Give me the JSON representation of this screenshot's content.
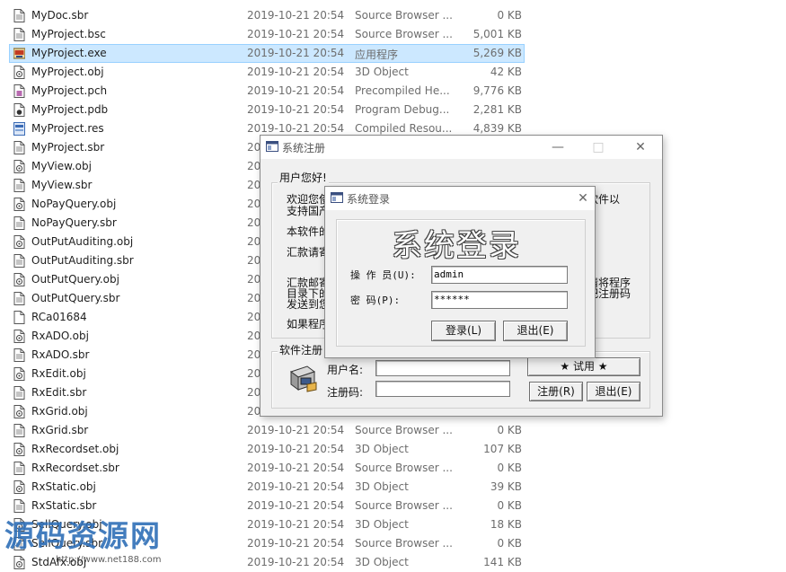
{
  "files": [
    {
      "name": "MyDoc.sbr",
      "date": "2019-10-21 20:54",
      "type": "Source Browser ...",
      "size": "0 KB",
      "icon": "doc-icon"
    },
    {
      "name": "MyProject.bsc",
      "date": "2019-10-21 20:54",
      "type": "Source Browser ...",
      "size": "5,001 KB",
      "icon": "doc-icon"
    },
    {
      "name": "MyProject.exe",
      "date": "2019-10-21 20:54",
      "type": "应用程序",
      "size": "5,269 KB",
      "icon": "exe-icon",
      "selected": true
    },
    {
      "name": "MyProject.obj",
      "date": "2019-10-21 20:54",
      "type": "3D Object",
      "size": "42 KB",
      "icon": "object-icon"
    },
    {
      "name": "MyProject.pch",
      "date": "2019-10-21 20:54",
      "type": "Precompiled He...",
      "size": "9,776 KB",
      "icon": "pch-icon"
    },
    {
      "name": "MyProject.pdb",
      "date": "2019-10-21 20:54",
      "type": "Program Debug...",
      "size": "2,281 KB",
      "icon": "pdb-icon"
    },
    {
      "name": "MyProject.res",
      "date": "2019-10-21 20:54",
      "type": "Compiled Resou...",
      "size": "4,839 KB",
      "icon": "res-icon"
    },
    {
      "name": "MyProject.sbr",
      "date": "20",
      "type": "",
      "size": "",
      "icon": "doc-icon"
    },
    {
      "name": "MyView.obj",
      "date": "20",
      "type": "",
      "size": "",
      "icon": "object-icon"
    },
    {
      "name": "MyView.sbr",
      "date": "20",
      "type": "",
      "size": "",
      "icon": "doc-icon"
    },
    {
      "name": "NoPayQuery.obj",
      "date": "20",
      "type": "",
      "size": "",
      "icon": "object-icon"
    },
    {
      "name": "NoPayQuery.sbr",
      "date": "20",
      "type": "",
      "size": "",
      "icon": "doc-icon"
    },
    {
      "name": "OutPutAuditing.obj",
      "date": "20",
      "type": "",
      "size": "",
      "icon": "object-icon"
    },
    {
      "name": "OutPutAuditing.sbr",
      "date": "20",
      "type": "",
      "size": "",
      "icon": "doc-icon"
    },
    {
      "name": "OutPutQuery.obj",
      "date": "20",
      "type": "",
      "size": "",
      "icon": "object-icon"
    },
    {
      "name": "OutPutQuery.sbr",
      "date": "20",
      "type": "",
      "size": "",
      "icon": "doc-icon"
    },
    {
      "name": "RCa01684",
      "date": "20",
      "type": "",
      "size": "",
      "icon": "blank-file-icon"
    },
    {
      "name": "RxADO.obj",
      "date": "20",
      "type": "",
      "size": "",
      "icon": "object-icon"
    },
    {
      "name": "RxADO.sbr",
      "date": "20",
      "type": "",
      "size": "",
      "icon": "doc-icon"
    },
    {
      "name": "RxEdit.obj",
      "date": "20",
      "type": "",
      "size": "",
      "icon": "object-icon"
    },
    {
      "name": "RxEdit.sbr",
      "date": "20",
      "type": "",
      "size": "",
      "icon": "doc-icon"
    },
    {
      "name": "RxGrid.obj",
      "date": "20",
      "type": "",
      "size": "",
      "icon": "object-icon"
    },
    {
      "name": "RxGrid.sbr",
      "date": "2019-10-21 20:54",
      "type": "Source Browser ...",
      "size": "0 KB",
      "icon": "doc-icon"
    },
    {
      "name": "RxRecordset.obj",
      "date": "2019-10-21 20:54",
      "type": "3D Object",
      "size": "107 KB",
      "icon": "object-icon"
    },
    {
      "name": "RxRecordset.sbr",
      "date": "2019-10-21 20:54",
      "type": "Source Browser ...",
      "size": "0 KB",
      "icon": "doc-icon"
    },
    {
      "name": "RxStatic.obj",
      "date": "2019-10-21 20:54",
      "type": "3D Object",
      "size": "39 KB",
      "icon": "object-icon"
    },
    {
      "name": "RxStatic.sbr",
      "date": "2019-10-21 20:54",
      "type": "Source Browser ...",
      "size": "0 KB",
      "icon": "doc-icon"
    },
    {
      "name": "SellQuery.obj",
      "date": "2019-10-21 20:54",
      "type": "3D Object",
      "size": "18 KB",
      "icon": "object-icon"
    },
    {
      "name": "SellQuery.sbr",
      "date": "2019-10-21 20:54",
      "type": "Source Browser ...",
      "size": "0 KB",
      "icon": "doc-icon"
    },
    {
      "name": "StdAfx.obj",
      "date": "2019-10-21 20:54",
      "type": "3D Object",
      "size": "141 KB",
      "icon": "object-icon"
    }
  ],
  "register_dialog": {
    "title": "系统注册",
    "greeting_group": "用户您好!",
    "line1": "欢迎您使",
    "line1_right": "软件以",
    "line2": "支持国产",
    "line3": "本软件的",
    "line4": "汇款请寄",
    "line5": "汇款邮寄",
    "line5_right": "请将程序",
    "line6": "目录下的",
    "line6_right": "把注册码",
    "line7": "发送到您",
    "line8": "如果程序",
    "reg_group": "软件注册",
    "username_label": "用户名:",
    "regcode_label": "注册码:",
    "trial_button": "★ 试用 ★",
    "register_button": "注册(R)",
    "exit_button": "退出(E)"
  },
  "login_dialog": {
    "title": "系统登录",
    "banner": "系统登录",
    "operator_label": "操 作 员(U):",
    "operator_value": "admin",
    "password_label": "密    码(P):",
    "password_value": "******",
    "login_button": "登录(L)",
    "exit_button": "退出(E)"
  },
  "watermark": {
    "text": "源码资源网",
    "url": "http://www.net188.com"
  },
  "colors": {
    "selection_bg": "#cce8ff",
    "selection_border": "#99d1ff",
    "dialog_bg": "#f0f0f0"
  }
}
